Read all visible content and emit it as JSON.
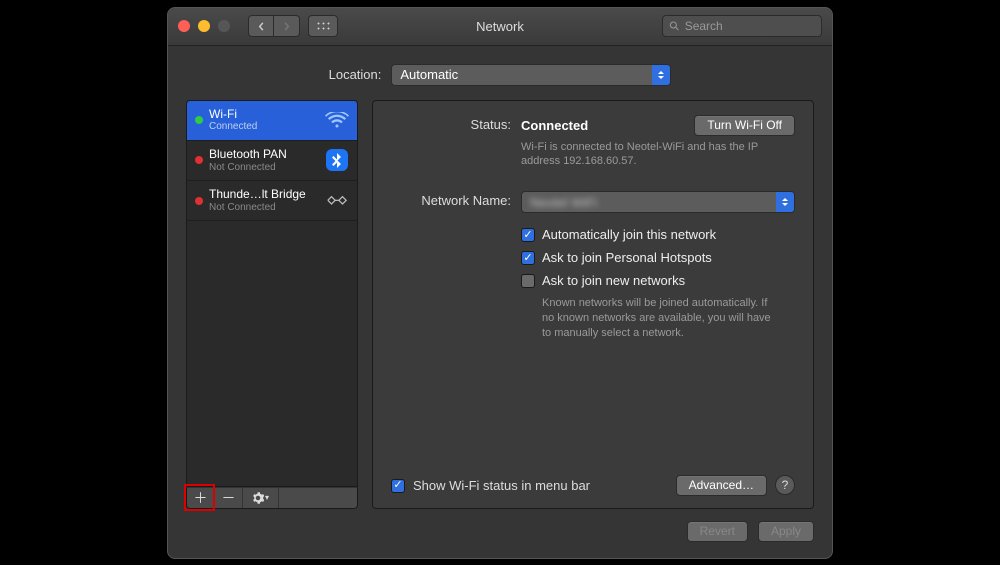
{
  "window": {
    "title": "Network",
    "search_placeholder": "Search"
  },
  "location": {
    "label": "Location:",
    "value": "Automatic"
  },
  "sidebar": {
    "items": [
      {
        "name": "Wi-Fi",
        "status_text": "Connected",
        "status": "green",
        "icon": "wifi",
        "selected": true
      },
      {
        "name": "Bluetooth PAN",
        "status_text": "Not Connected",
        "status": "red",
        "icon": "bluetooth",
        "selected": false
      },
      {
        "name": "Thunde…lt Bridge",
        "status_text": "Not Connected",
        "status": "red",
        "icon": "thunderbolt",
        "selected": false
      }
    ]
  },
  "detail": {
    "status_label": "Status:",
    "status_value": "Connected",
    "turn_off_label": "Turn Wi-Fi Off",
    "status_desc": "Wi-Fi is connected to Neotel-WiFi and has the IP address 192.168.60.57.",
    "network_name_label": "Network Name:",
    "network_name_value": "Neotel WiFi",
    "auto_join_label": "Automatically join this network",
    "auto_join_checked": true,
    "ask_hotspots_label": "Ask to join Personal Hotspots",
    "ask_hotspots_checked": true,
    "ask_new_label": "Ask to join new networks",
    "ask_new_checked": false,
    "ask_new_desc": "Known networks will be joined automatically. If no known networks are available, you will have to manually select a network.",
    "show_menu_label": "Show Wi-Fi status in menu bar",
    "show_menu_checked": true,
    "advanced_label": "Advanced…"
  },
  "footer": {
    "revert_label": "Revert",
    "apply_label": "Apply"
  }
}
